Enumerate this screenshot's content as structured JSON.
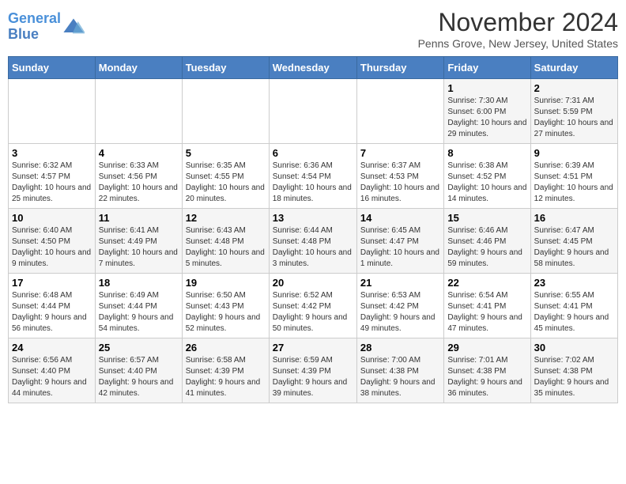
{
  "header": {
    "logo_line1": "General",
    "logo_line2": "Blue",
    "month": "November 2024",
    "location": "Penns Grove, New Jersey, United States"
  },
  "weekdays": [
    "Sunday",
    "Monday",
    "Tuesday",
    "Wednesday",
    "Thursday",
    "Friday",
    "Saturday"
  ],
  "weeks": [
    [
      {
        "day": "",
        "info": ""
      },
      {
        "day": "",
        "info": ""
      },
      {
        "day": "",
        "info": ""
      },
      {
        "day": "",
        "info": ""
      },
      {
        "day": "",
        "info": ""
      },
      {
        "day": "1",
        "info": "Sunrise: 7:30 AM\nSunset: 6:00 PM\nDaylight: 10 hours and 29 minutes."
      },
      {
        "day": "2",
        "info": "Sunrise: 7:31 AM\nSunset: 5:59 PM\nDaylight: 10 hours and 27 minutes."
      }
    ],
    [
      {
        "day": "3",
        "info": "Sunrise: 6:32 AM\nSunset: 4:57 PM\nDaylight: 10 hours and 25 minutes."
      },
      {
        "day": "4",
        "info": "Sunrise: 6:33 AM\nSunset: 4:56 PM\nDaylight: 10 hours and 22 minutes."
      },
      {
        "day": "5",
        "info": "Sunrise: 6:35 AM\nSunset: 4:55 PM\nDaylight: 10 hours and 20 minutes."
      },
      {
        "day": "6",
        "info": "Sunrise: 6:36 AM\nSunset: 4:54 PM\nDaylight: 10 hours and 18 minutes."
      },
      {
        "day": "7",
        "info": "Sunrise: 6:37 AM\nSunset: 4:53 PM\nDaylight: 10 hours and 16 minutes."
      },
      {
        "day": "8",
        "info": "Sunrise: 6:38 AM\nSunset: 4:52 PM\nDaylight: 10 hours and 14 minutes."
      },
      {
        "day": "9",
        "info": "Sunrise: 6:39 AM\nSunset: 4:51 PM\nDaylight: 10 hours and 12 minutes."
      }
    ],
    [
      {
        "day": "10",
        "info": "Sunrise: 6:40 AM\nSunset: 4:50 PM\nDaylight: 10 hours and 9 minutes."
      },
      {
        "day": "11",
        "info": "Sunrise: 6:41 AM\nSunset: 4:49 PM\nDaylight: 10 hours and 7 minutes."
      },
      {
        "day": "12",
        "info": "Sunrise: 6:43 AM\nSunset: 4:48 PM\nDaylight: 10 hours and 5 minutes."
      },
      {
        "day": "13",
        "info": "Sunrise: 6:44 AM\nSunset: 4:48 PM\nDaylight: 10 hours and 3 minutes."
      },
      {
        "day": "14",
        "info": "Sunrise: 6:45 AM\nSunset: 4:47 PM\nDaylight: 10 hours and 1 minute."
      },
      {
        "day": "15",
        "info": "Sunrise: 6:46 AM\nSunset: 4:46 PM\nDaylight: 9 hours and 59 minutes."
      },
      {
        "day": "16",
        "info": "Sunrise: 6:47 AM\nSunset: 4:45 PM\nDaylight: 9 hours and 58 minutes."
      }
    ],
    [
      {
        "day": "17",
        "info": "Sunrise: 6:48 AM\nSunset: 4:44 PM\nDaylight: 9 hours and 56 minutes."
      },
      {
        "day": "18",
        "info": "Sunrise: 6:49 AM\nSunset: 4:44 PM\nDaylight: 9 hours and 54 minutes."
      },
      {
        "day": "19",
        "info": "Sunrise: 6:50 AM\nSunset: 4:43 PM\nDaylight: 9 hours and 52 minutes."
      },
      {
        "day": "20",
        "info": "Sunrise: 6:52 AM\nSunset: 4:42 PM\nDaylight: 9 hours and 50 minutes."
      },
      {
        "day": "21",
        "info": "Sunrise: 6:53 AM\nSunset: 4:42 PM\nDaylight: 9 hours and 49 minutes."
      },
      {
        "day": "22",
        "info": "Sunrise: 6:54 AM\nSunset: 4:41 PM\nDaylight: 9 hours and 47 minutes."
      },
      {
        "day": "23",
        "info": "Sunrise: 6:55 AM\nSunset: 4:41 PM\nDaylight: 9 hours and 45 minutes."
      }
    ],
    [
      {
        "day": "24",
        "info": "Sunrise: 6:56 AM\nSunset: 4:40 PM\nDaylight: 9 hours and 44 minutes."
      },
      {
        "day": "25",
        "info": "Sunrise: 6:57 AM\nSunset: 4:40 PM\nDaylight: 9 hours and 42 minutes."
      },
      {
        "day": "26",
        "info": "Sunrise: 6:58 AM\nSunset: 4:39 PM\nDaylight: 9 hours and 41 minutes."
      },
      {
        "day": "27",
        "info": "Sunrise: 6:59 AM\nSunset: 4:39 PM\nDaylight: 9 hours and 39 minutes."
      },
      {
        "day": "28",
        "info": "Sunrise: 7:00 AM\nSunset: 4:38 PM\nDaylight: 9 hours and 38 minutes."
      },
      {
        "day": "29",
        "info": "Sunrise: 7:01 AM\nSunset: 4:38 PM\nDaylight: 9 hours and 36 minutes."
      },
      {
        "day": "30",
        "info": "Sunrise: 7:02 AM\nSunset: 4:38 PM\nDaylight: 9 hours and 35 minutes."
      }
    ]
  ]
}
